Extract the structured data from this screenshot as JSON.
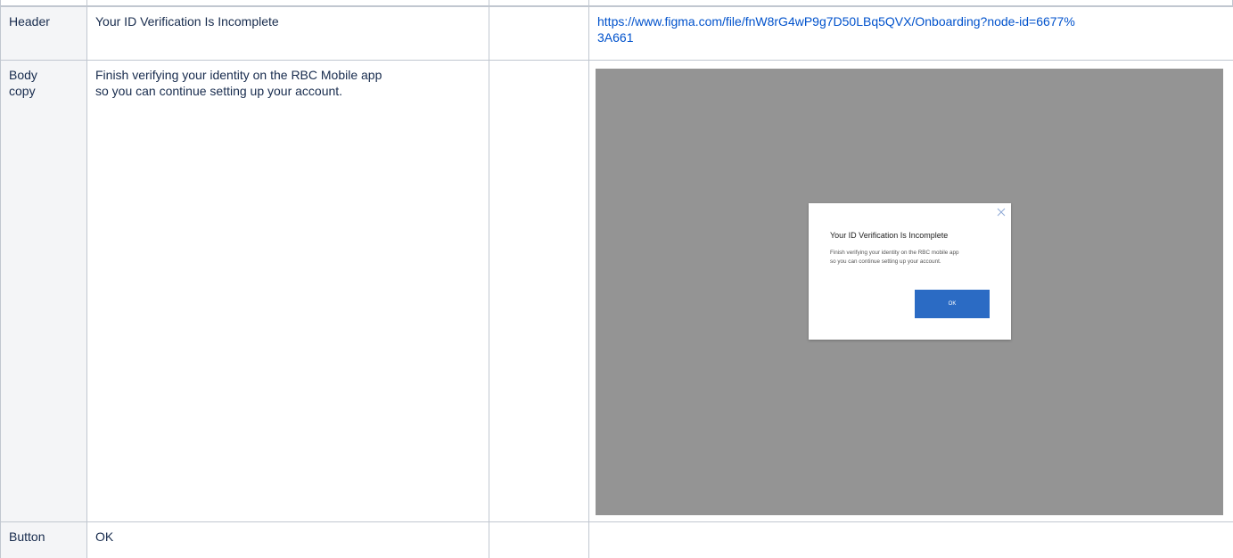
{
  "rows": [
    {
      "label": "Header",
      "content": "Your ID Verification Is Incomplete",
      "notes": "",
      "link_line1": "https://www.figma.com/file/fnW8rG4wP9g7D50LBq5QVX/Onboarding?node-id=6677%",
      "link_line2": "3A661"
    },
    {
      "label": "Body\ncopy",
      "label_line1": "Body",
      "label_line2": "copy",
      "content_line1": "Finish verifying your identity on the RBC Mobile app",
      "content_line2": "so you can continue setting up your account.",
      "notes": ""
    },
    {
      "label": "Button",
      "content": "OK",
      "notes": ""
    }
  ],
  "preview": {
    "backdrop_color": "#949494",
    "dialog": {
      "title": "Your ID Verification Is Incomplete",
      "body_line1": "Finish verifying your identity on the RBC mobile app",
      "body_line2": "so you can continue setting up your account.",
      "ok_label": "OK",
      "ok_color": "#2b6bc4",
      "close_icon": "close-icon"
    }
  },
  "colors": {
    "link": "#0052cc",
    "grid": "#c1c7d0",
    "label_bg": "#f4f5f7"
  }
}
